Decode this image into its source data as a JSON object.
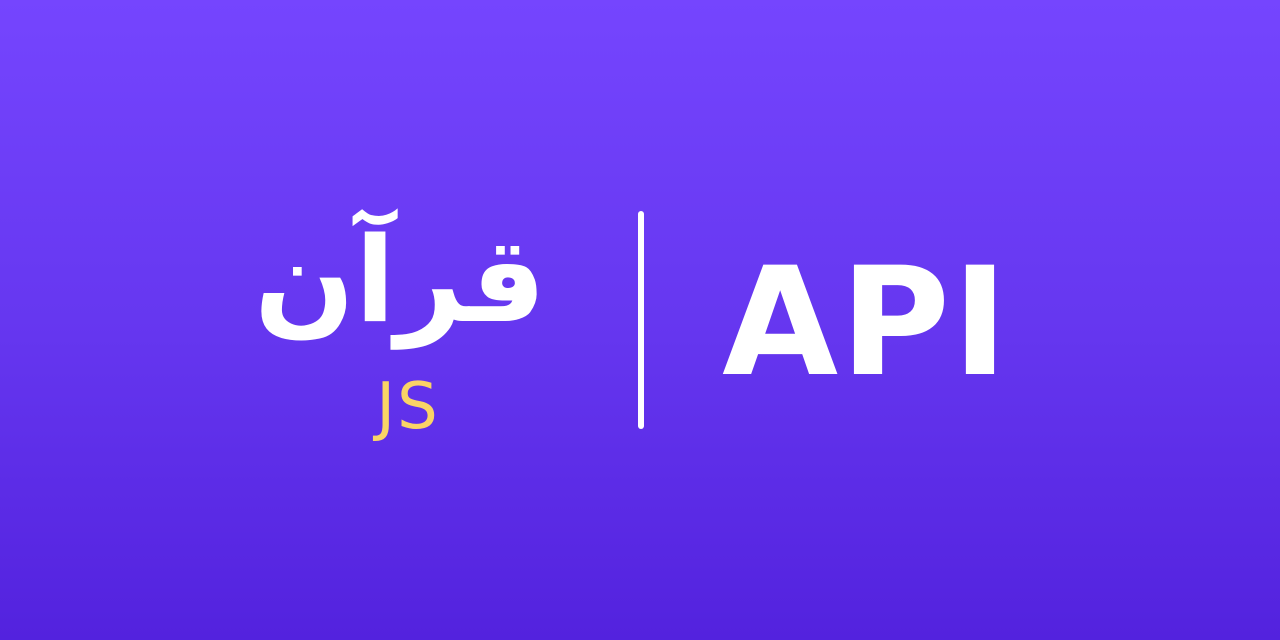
{
  "banner": {
    "arabic_title": "قرآن",
    "subtitle": "JS",
    "api_label": "API"
  },
  "colors": {
    "background_top": "#7545FE",
    "background_bottom": "#5322DE",
    "text_primary": "#FFFFFF",
    "accent": "#FAD466"
  }
}
